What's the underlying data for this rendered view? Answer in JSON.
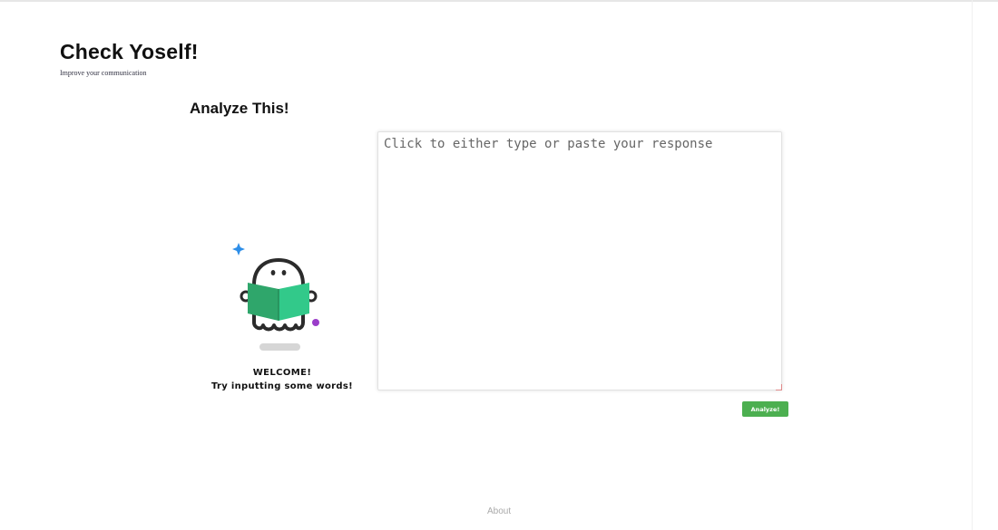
{
  "header": {
    "title": "Check Yoself!",
    "subtitle": "Improve your communication"
  },
  "main": {
    "section_title": "Analyze This!",
    "input": {
      "placeholder": "Click to either type or paste your response",
      "value": ""
    },
    "analyze_button_label": "Analyze!",
    "welcome": {
      "title": "WELCOME!",
      "message": "Try inputting some words!",
      "illustration": "reading-ghost-icon"
    }
  },
  "footer": {
    "about_label": "About"
  },
  "colors": {
    "accent_green": "#4caf50",
    "book_green": "#2fbf7f",
    "sparkle_blue": "#2d8ee8",
    "dot_purple": "#9a3dc9"
  }
}
